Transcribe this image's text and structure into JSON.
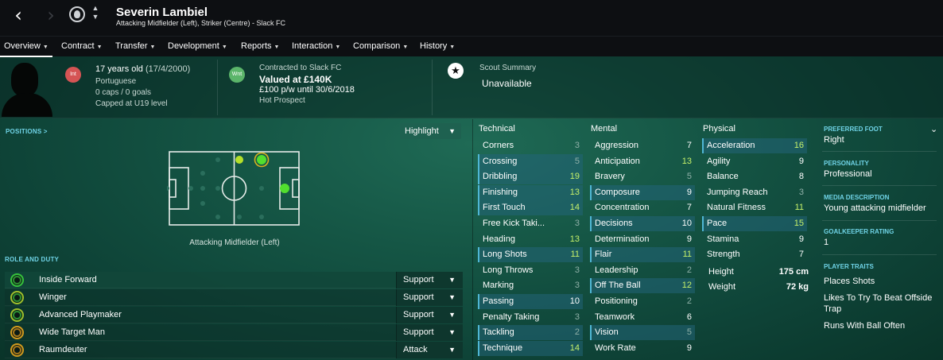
{
  "header": {
    "player_name": "Severin Lambiel",
    "player_subtitle": "Attacking Midfielder (Left), Striker (Centre) - Slack FC"
  },
  "menu": [
    {
      "label": "Overview",
      "active": true
    },
    {
      "label": "Contract"
    },
    {
      "label": "Transfer"
    },
    {
      "label": "Development"
    },
    {
      "label": "Reports"
    },
    {
      "label": "Interaction"
    },
    {
      "label": "Comparison"
    },
    {
      "label": "History"
    }
  ],
  "info": {
    "int_badge": "Int",
    "age": "17 years old",
    "dob": "(17/4/2000)",
    "nationality": "Portuguese",
    "caps": "0 caps / 0 goals",
    "capped": "Capped at U19 level",
    "wnt_badge": "Wnt",
    "contracted": "Contracted to Slack FC",
    "valued": "Valued at £140K",
    "wage": "£100 p/w until 30/6/2018",
    "prospect": "Hot Prospect",
    "scout_title": "Scout Summary",
    "scout_value": "Unavailable"
  },
  "positions": {
    "label": "POSITIONS >",
    "highlight": "Highlight",
    "caption": "Attacking Midfielder (Left)"
  },
  "roles": {
    "label": "ROLE AND DUTY",
    "items": [
      {
        "name": "Inside Forward",
        "duty": "Support"
      },
      {
        "name": "Winger",
        "duty": "Support"
      },
      {
        "name": "Advanced Playmaker",
        "duty": "Support"
      },
      {
        "name": "Wide Target Man",
        "duty": "Support"
      },
      {
        "name": "Raumdeuter",
        "duty": "Attack"
      }
    ]
  },
  "attributes": {
    "technical_title": "Technical",
    "mental_title": "Mental",
    "physical_title": "Physical",
    "technical": [
      {
        "name": "Corners",
        "value": "3"
      },
      {
        "name": "Crossing",
        "value": "5"
      },
      {
        "name": "Dribbling",
        "value": "19"
      },
      {
        "name": "Finishing",
        "value": "13"
      },
      {
        "name": "First Touch",
        "value": "14"
      },
      {
        "name": "Free Kick Taki...",
        "value": "3"
      },
      {
        "name": "Heading",
        "value": "13"
      },
      {
        "name": "Long Shots",
        "value": "11"
      },
      {
        "name": "Long Throws",
        "value": "3"
      },
      {
        "name": "Marking",
        "value": "3"
      },
      {
        "name": "Passing",
        "value": "10"
      },
      {
        "name": "Penalty Taking",
        "value": "3"
      },
      {
        "name": "Tackling",
        "value": "2"
      },
      {
        "name": "Technique",
        "value": "14"
      }
    ],
    "mental": [
      {
        "name": "Aggression",
        "value": "7"
      },
      {
        "name": "Anticipation",
        "value": "13"
      },
      {
        "name": "Bravery",
        "value": "5"
      },
      {
        "name": "Composure",
        "value": "9"
      },
      {
        "name": "Concentration",
        "value": "7"
      },
      {
        "name": "Decisions",
        "value": "10"
      },
      {
        "name": "Determination",
        "value": "9"
      },
      {
        "name": "Flair",
        "value": "11"
      },
      {
        "name": "Leadership",
        "value": "2"
      },
      {
        "name": "Off The Ball",
        "value": "12"
      },
      {
        "name": "Positioning",
        "value": "2"
      },
      {
        "name": "Teamwork",
        "value": "6"
      },
      {
        "name": "Vision",
        "value": "5"
      },
      {
        "name": "Work Rate",
        "value": "9"
      }
    ],
    "physical": [
      {
        "name": "Acceleration",
        "value": "16"
      },
      {
        "name": "Agility",
        "value": "9"
      },
      {
        "name": "Balance",
        "value": "8"
      },
      {
        "name": "Jumping Reach",
        "value": "3"
      },
      {
        "name": "Natural Fitness",
        "value": "11"
      },
      {
        "name": "Pace",
        "value": "15"
      },
      {
        "name": "Stamina",
        "value": "9"
      },
      {
        "name": "Strength",
        "value": "7"
      }
    ],
    "height_label": "Height",
    "height_value": "175 cm",
    "weight_label": "Weight",
    "weight_value": "72 kg"
  },
  "side": {
    "preferred_foot_label": "PREFERRED FOOT",
    "preferred_foot": "Right",
    "personality_label": "PERSONALITY",
    "personality": "Professional",
    "media_label": "MEDIA DESCRIPTION",
    "media": "Young attacking midfielder",
    "gk_label": "GOALKEEPER RATING",
    "gk": "1",
    "traits_label": "PLAYER TRAITS",
    "traits": [
      "Places Shots",
      "Likes To Try To Beat Offside Trap",
      "Runs With Ball Often"
    ]
  }
}
